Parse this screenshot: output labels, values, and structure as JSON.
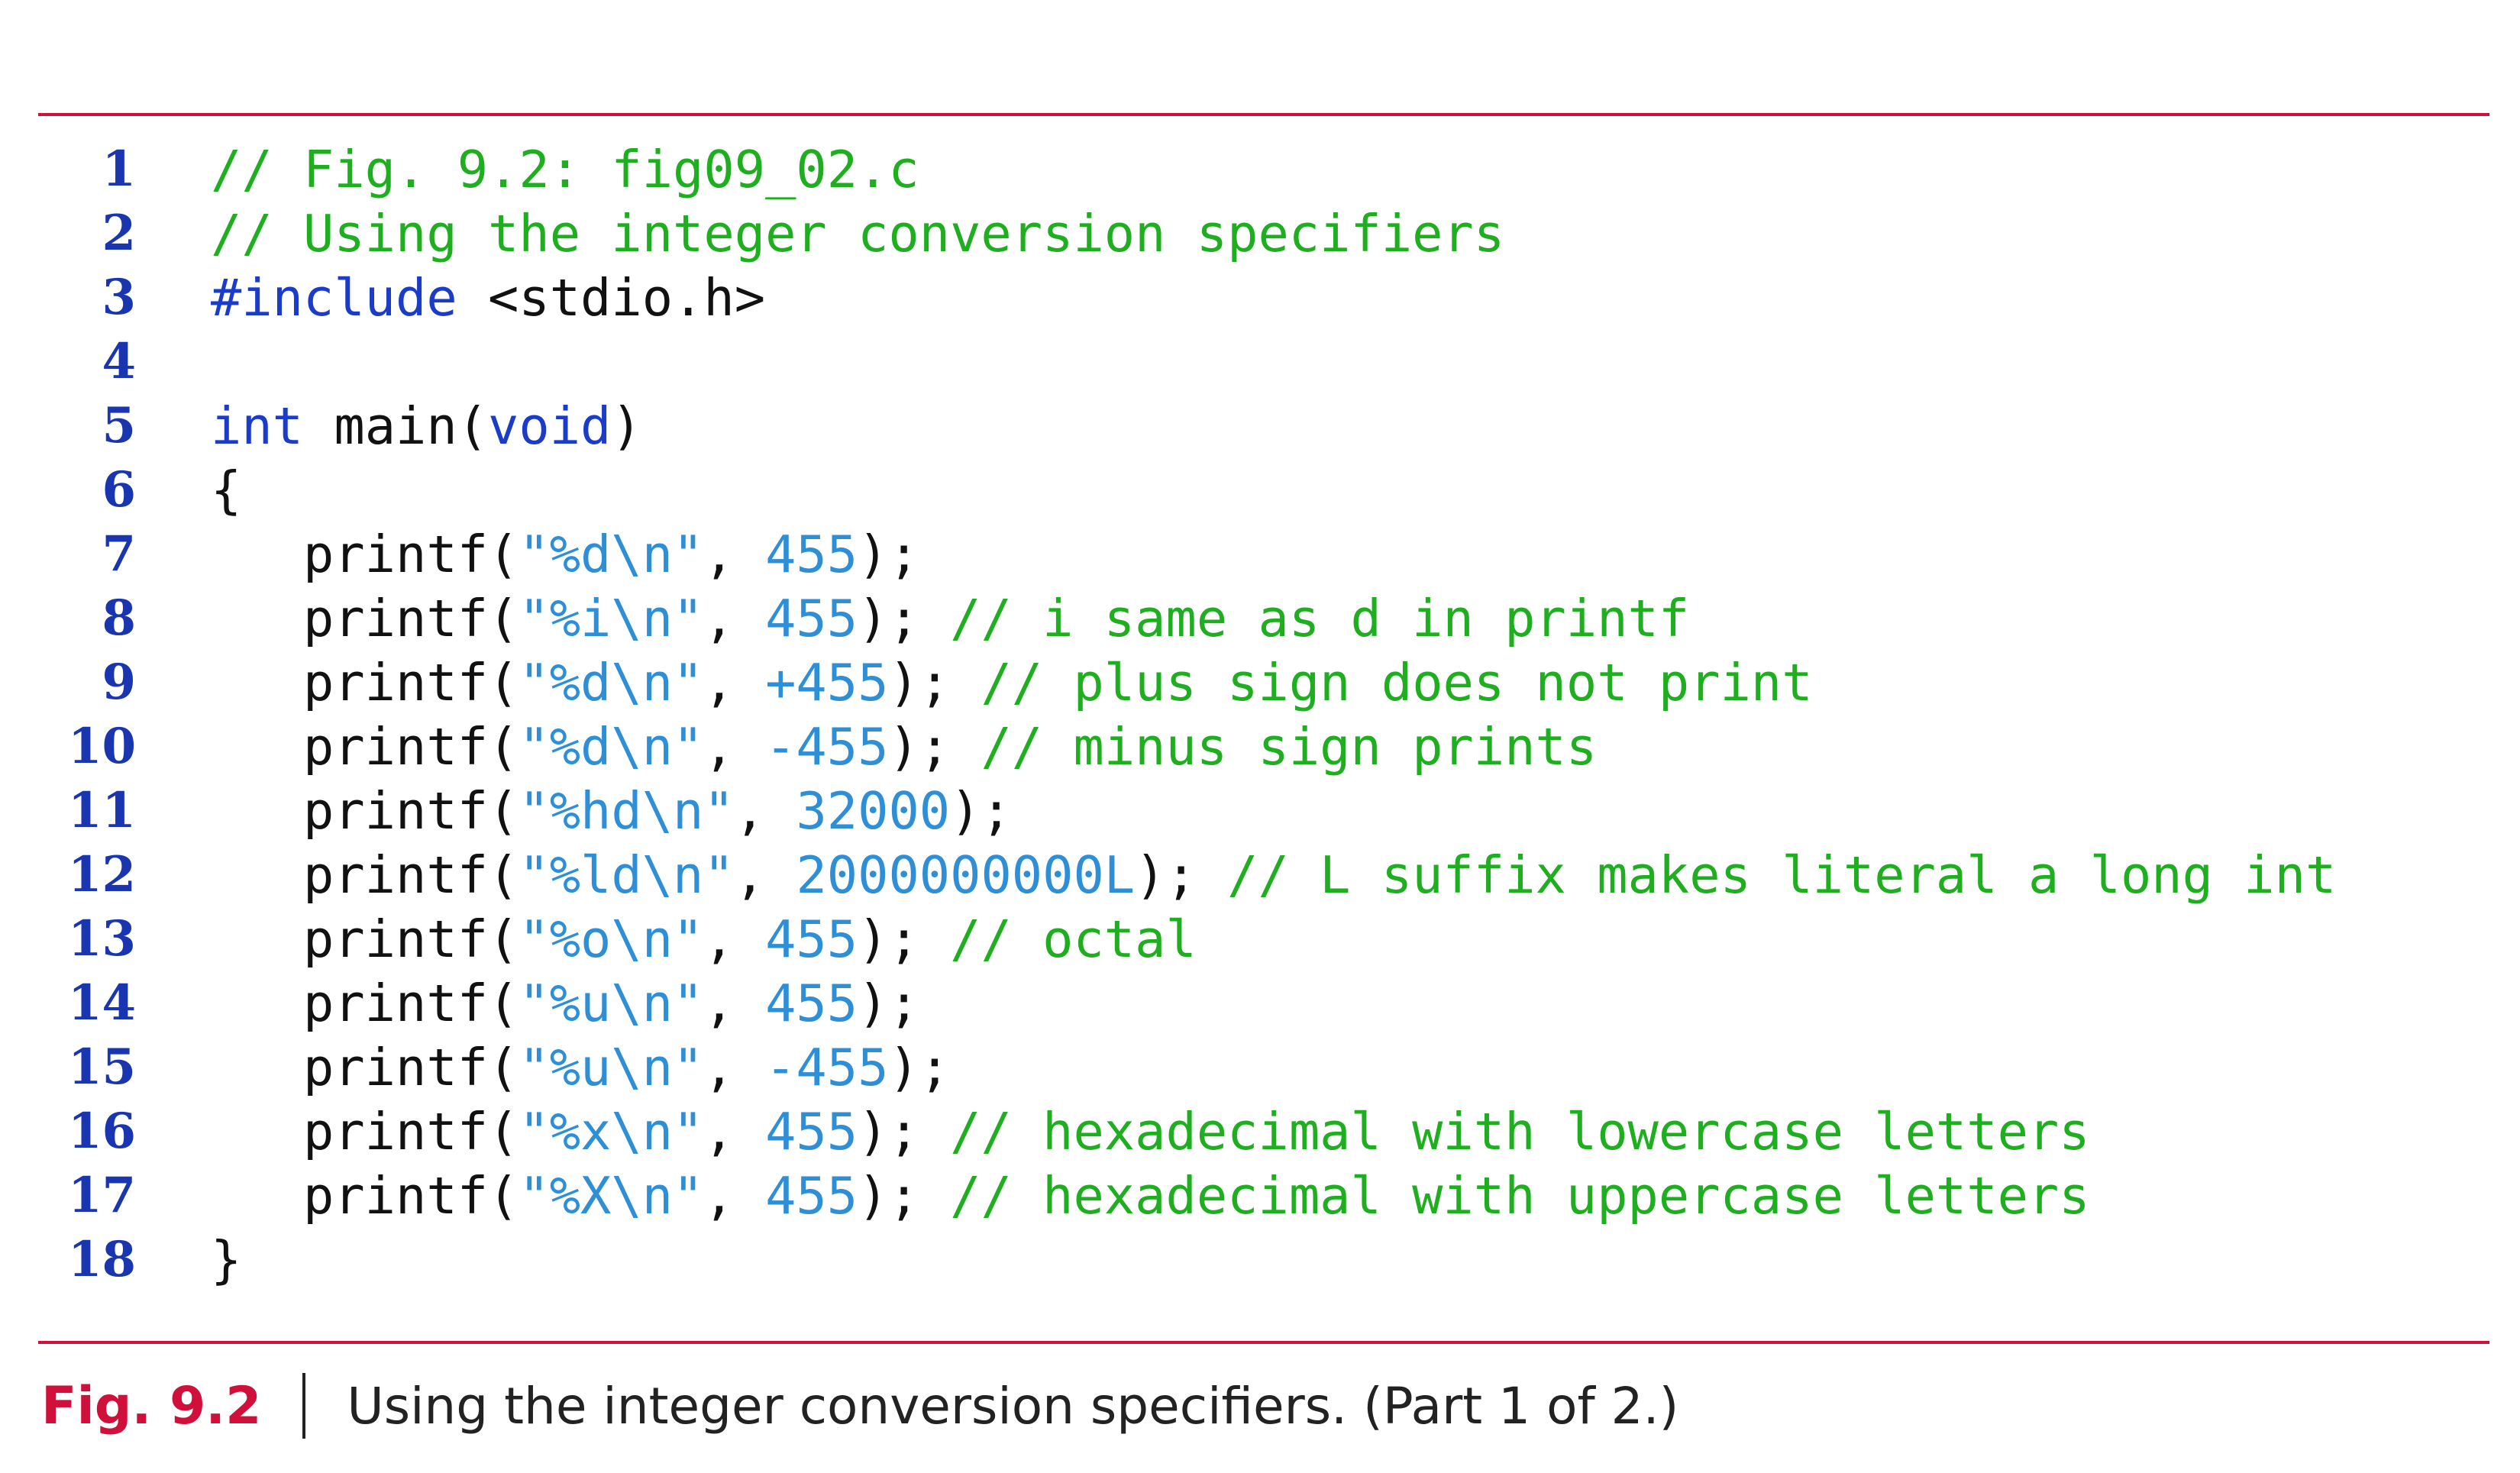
{
  "code": {
    "lines": [
      {
        "num": "1",
        "tokens": [
          {
            "t": "// Fig. 9.2: fig09_02.c",
            "k": "comment"
          }
        ]
      },
      {
        "num": "2",
        "tokens": [
          {
            "t": "// Using the integer conversion specifiers",
            "k": "comment"
          }
        ]
      },
      {
        "num": "3",
        "tokens": [
          {
            "t": "#include",
            "k": "keyword"
          },
          {
            "t": " <stdio.h>",
            "k": "plain"
          }
        ]
      },
      {
        "num": "4",
        "tokens": []
      },
      {
        "num": "5",
        "tokens": [
          {
            "t": "int",
            "k": "keyword"
          },
          {
            "t": " main(",
            "k": "plain"
          },
          {
            "t": "void",
            "k": "keyword"
          },
          {
            "t": ")",
            "k": "plain"
          }
        ]
      },
      {
        "num": "6",
        "tokens": [
          {
            "t": "{",
            "k": "plain"
          }
        ]
      },
      {
        "num": "7",
        "tokens": [
          {
            "t": "   printf(",
            "k": "plain"
          },
          {
            "t": "\"%d\\n\"",
            "k": "string"
          },
          {
            "t": ", ",
            "k": "plain"
          },
          {
            "t": "455",
            "k": "number"
          },
          {
            "t": ");",
            "k": "plain"
          }
        ]
      },
      {
        "num": "8",
        "tokens": [
          {
            "t": "   printf(",
            "k": "plain"
          },
          {
            "t": "\"%i\\n\"",
            "k": "string"
          },
          {
            "t": ", ",
            "k": "plain"
          },
          {
            "t": "455",
            "k": "number"
          },
          {
            "t": "); ",
            "k": "plain"
          },
          {
            "t": "// i same as d in printf",
            "k": "comment"
          }
        ]
      },
      {
        "num": "9",
        "tokens": [
          {
            "t": "   printf(",
            "k": "plain"
          },
          {
            "t": "\"%d\\n\"",
            "k": "string"
          },
          {
            "t": ", ",
            "k": "plain"
          },
          {
            "t": "+455",
            "k": "number"
          },
          {
            "t": "); ",
            "k": "plain"
          },
          {
            "t": "// plus sign does not print",
            "k": "comment"
          }
        ]
      },
      {
        "num": "10",
        "tokens": [
          {
            "t": "   printf(",
            "k": "plain"
          },
          {
            "t": "\"%d\\n\"",
            "k": "string"
          },
          {
            "t": ", ",
            "k": "plain"
          },
          {
            "t": "-455",
            "k": "number"
          },
          {
            "t": "); ",
            "k": "plain"
          },
          {
            "t": "// minus sign prints",
            "k": "comment"
          }
        ]
      },
      {
        "num": "11",
        "tokens": [
          {
            "t": "   printf(",
            "k": "plain"
          },
          {
            "t": "\"%hd\\n\"",
            "k": "string"
          },
          {
            "t": ", ",
            "k": "plain"
          },
          {
            "t": "32000",
            "k": "number"
          },
          {
            "t": ");",
            "k": "plain"
          }
        ]
      },
      {
        "num": "12",
        "tokens": [
          {
            "t": "   printf(",
            "k": "plain"
          },
          {
            "t": "\"%ld\\n\"",
            "k": "string"
          },
          {
            "t": ", ",
            "k": "plain"
          },
          {
            "t": "2000000000L",
            "k": "number"
          },
          {
            "t": "); ",
            "k": "plain"
          },
          {
            "t": "// L suffix makes literal a long int",
            "k": "comment"
          }
        ]
      },
      {
        "num": "13",
        "tokens": [
          {
            "t": "   printf(",
            "k": "plain"
          },
          {
            "t": "\"%o\\n\"",
            "k": "string"
          },
          {
            "t": ", ",
            "k": "plain"
          },
          {
            "t": "455",
            "k": "number"
          },
          {
            "t": "); ",
            "k": "plain"
          },
          {
            "t": "// octal",
            "k": "comment"
          }
        ]
      },
      {
        "num": "14",
        "tokens": [
          {
            "t": "   printf(",
            "k": "plain"
          },
          {
            "t": "\"%u\\n\"",
            "k": "string"
          },
          {
            "t": ", ",
            "k": "plain"
          },
          {
            "t": "455",
            "k": "number"
          },
          {
            "t": ");",
            "k": "plain"
          }
        ]
      },
      {
        "num": "15",
        "tokens": [
          {
            "t": "   printf(",
            "k": "plain"
          },
          {
            "t": "\"%u\\n\"",
            "k": "string"
          },
          {
            "t": ", ",
            "k": "plain"
          },
          {
            "t": "-455",
            "k": "number"
          },
          {
            "t": ");",
            "k": "plain"
          }
        ]
      },
      {
        "num": "16",
        "tokens": [
          {
            "t": "   printf(",
            "k": "plain"
          },
          {
            "t": "\"%x\\n\"",
            "k": "string"
          },
          {
            "t": ", ",
            "k": "plain"
          },
          {
            "t": "455",
            "k": "number"
          },
          {
            "t": "); ",
            "k": "plain"
          },
          {
            "t": "// hexadecimal with lowercase letters",
            "k": "comment"
          }
        ]
      },
      {
        "num": "17",
        "tokens": [
          {
            "t": "   printf(",
            "k": "plain"
          },
          {
            "t": "\"%X\\n\"",
            "k": "string"
          },
          {
            "t": ", ",
            "k": "plain"
          },
          {
            "t": "455",
            "k": "number"
          },
          {
            "t": "); ",
            "k": "plain"
          },
          {
            "t": "// hexadecimal with uppercase letters",
            "k": "comment"
          }
        ]
      },
      {
        "num": "18",
        "tokens": [
          {
            "t": "}",
            "k": "plain"
          }
        ]
      }
    ]
  },
  "caption": {
    "label": "Fig. 9.2",
    "text": "Using the integer conversion specifiers. (Part 1 of 2.)"
  },
  "colors": {
    "rule": "#d0103a",
    "line_numbers": "#1a35b0",
    "comment": "#1fae1f",
    "keyword": "#1a3cc8",
    "literal": "#2f8fd6",
    "code_text": "#111111"
  }
}
